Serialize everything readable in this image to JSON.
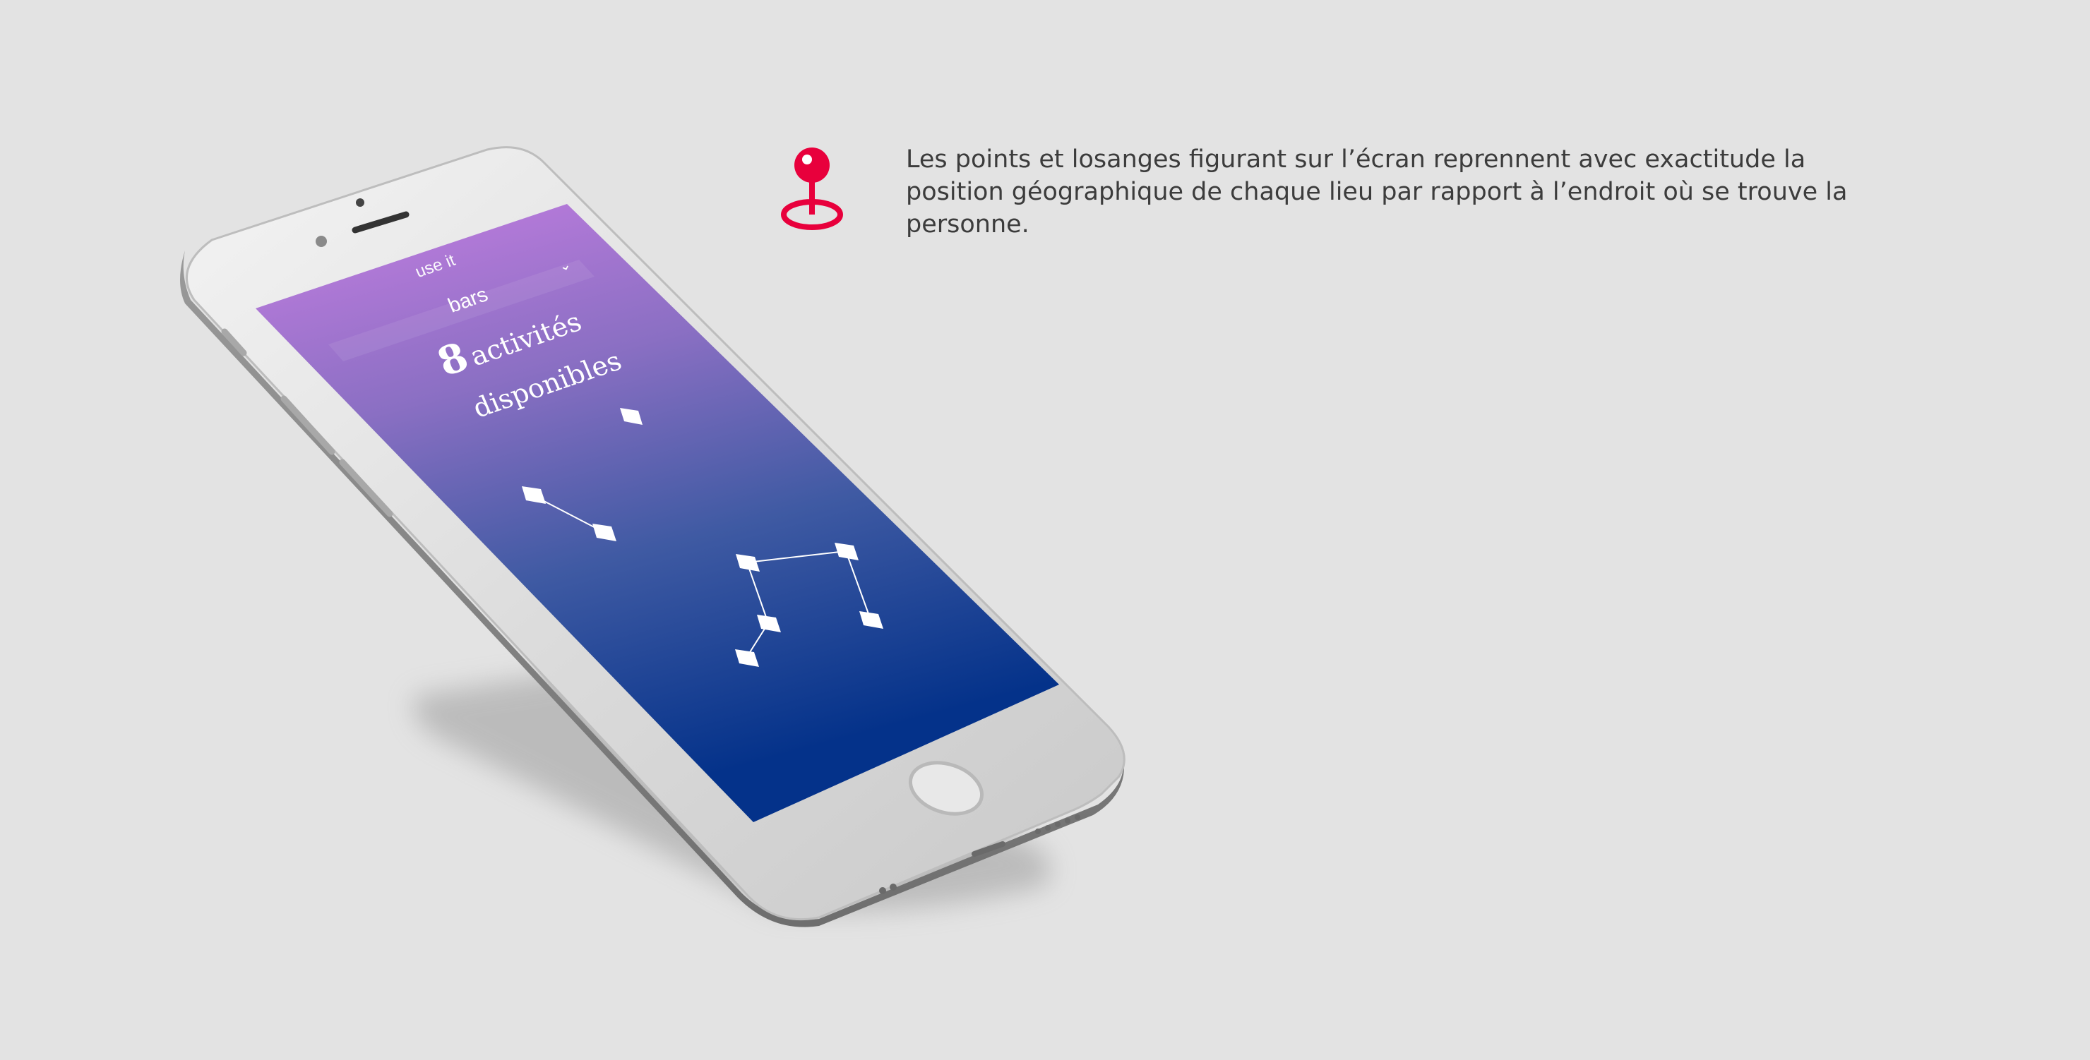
{
  "phone": {
    "nav_title": "use it",
    "dropdown_icon": "chevron-down-icon",
    "category": "bars",
    "activity_count": "8",
    "activity_label_line1": "activités",
    "activity_label_line2": "disponibles"
  },
  "annotation": {
    "icon": "map-pin-icon",
    "icon_color": "#e8003c",
    "text": "Les points et losanges figurant sur l’écran reprennent avec exactitude la position géographique de chaque lieu par rapport à l’endroit où se trouve la personne."
  },
  "colors": {
    "background": "#e3e3e3",
    "screen_gradient_top": "#c47be0",
    "screen_gradient_bottom": "#04328a"
  }
}
